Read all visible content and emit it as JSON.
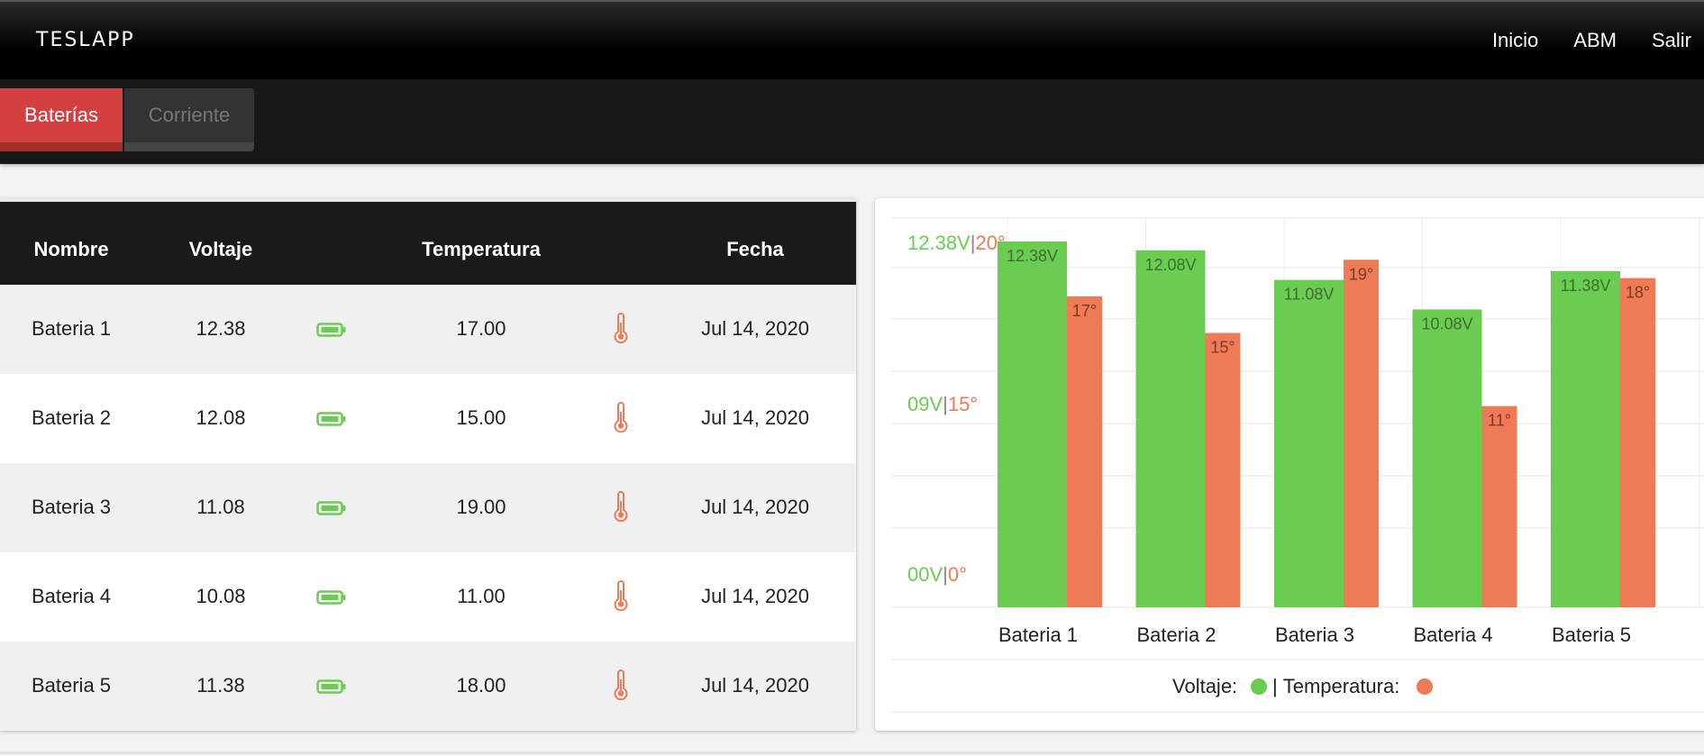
{
  "app": {
    "brand": "TESLAPP"
  },
  "nav": {
    "items": [
      {
        "label": "Inicio"
      },
      {
        "label": "ABM"
      },
      {
        "label": "Salir"
      }
    ]
  },
  "tabs": [
    {
      "label": "Baterías",
      "active": true
    },
    {
      "label": "Corriente",
      "active": false
    }
  ],
  "table": {
    "headers": {
      "name": "Nombre",
      "voltage": "Voltaje",
      "temperature": "Temperatura",
      "date": "Fecha"
    },
    "rows": [
      {
        "name": "Bateria 1",
        "voltage": "12.38",
        "temperature": "17.00",
        "date": "Jul 14, 2020"
      },
      {
        "name": "Bateria 2",
        "voltage": "12.08",
        "temperature": "15.00",
        "date": "Jul 14, 2020"
      },
      {
        "name": "Bateria 3",
        "voltage": "11.08",
        "temperature": "19.00",
        "date": "Jul 14, 2020"
      },
      {
        "name": "Bateria 4",
        "voltage": "10.08",
        "temperature": "11.00",
        "date": "Jul 14, 2020"
      },
      {
        "name": "Bateria 5",
        "voltage": "11.38",
        "temperature": "18.00",
        "date": "Jul 14, 2020"
      }
    ]
  },
  "colors": {
    "voltage": "#6acc50",
    "temperature": "#ee7b56",
    "accent": "#d43f3f"
  },
  "icons": {
    "battery": "battery-icon",
    "thermometer": "thermometer-icon"
  },
  "chart_data": {
    "type": "bar",
    "categories": [
      "Bateria 1",
      "Bateria 2",
      "Bateria 3",
      "Bateria 4",
      "Bateria 5"
    ],
    "series": [
      {
        "name": "Voltaje",
        "values": [
          12.38,
          12.08,
          11.08,
          10.08,
          11.38
        ],
        "labels": [
          "12.38V",
          "12.08V",
          "11.08V",
          "10.08V",
          "11.38V"
        ]
      },
      {
        "name": "Temperatura",
        "values": [
          17,
          15,
          19,
          11,
          18
        ],
        "labels": [
          "17°",
          "15°",
          "19°",
          "11°",
          "18°"
        ]
      }
    ],
    "y_ticks": [
      {
        "voltage": "12.38V",
        "temperature": "20°"
      },
      {
        "voltage": "09V",
        "temperature": "15°"
      },
      {
        "voltage": "00V",
        "temperature": "0°"
      }
    ],
    "separator": "|",
    "legend": {
      "voltage_label": "Voltaje:",
      "separator": "|",
      "temperature_label": "Temperatura:"
    },
    "grid": true
  }
}
